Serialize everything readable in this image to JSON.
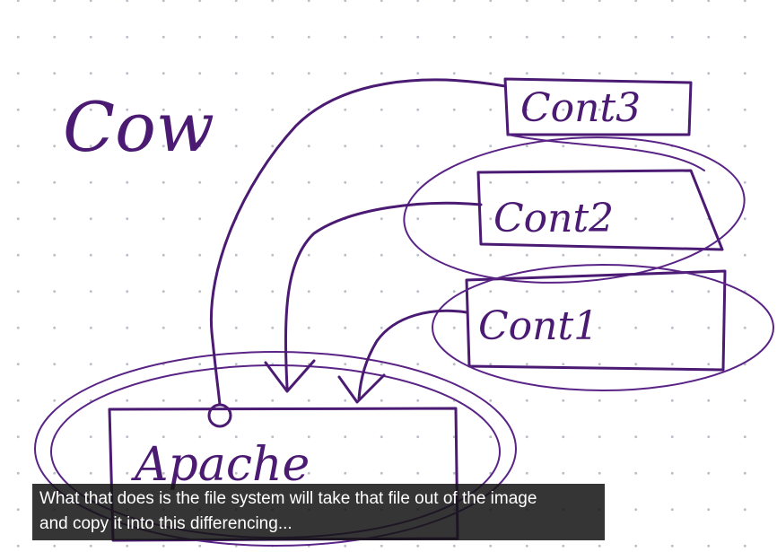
{
  "diagram": {
    "title": "Cow",
    "nodes": {
      "base_image": "Apache",
      "container_1": "Cont1",
      "container_2": "Cont2",
      "container_3": "Cont3"
    },
    "ink_color": "#4b1a72"
  },
  "caption": {
    "line1": "What that does is the file system will take that file out of the image",
    "line2": "and copy it into this differencing..."
  }
}
